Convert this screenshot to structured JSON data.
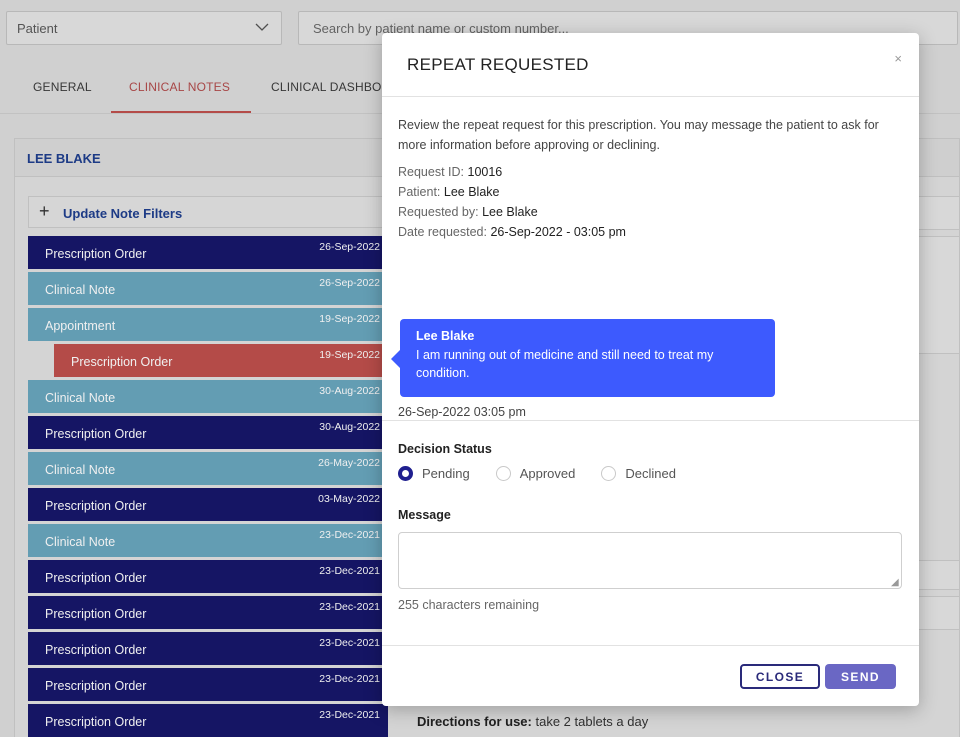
{
  "topbar": {
    "patient_select": {
      "value": "Patient",
      "icon": "chevron-down-icon"
    },
    "search": {
      "placeholder": "Search by patient name or custom number..."
    }
  },
  "tabs": [
    {
      "label": "GENERAL",
      "active": false
    },
    {
      "label": "CLINICAL NOTES",
      "active": true
    },
    {
      "label": "CLINICAL DASHBO",
      "active": false
    }
  ],
  "patient_card": {
    "title": "LEE BLAKE",
    "filter_button": {
      "icon": "plus-icon",
      "label": "Update Note Filters"
    },
    "notes": [
      {
        "label": "Prescription Order",
        "date": "26-Sep-2022",
        "kind": "dark"
      },
      {
        "label": "Clinical Note",
        "date": "26-Sep-2022",
        "kind": "light"
      },
      {
        "label": "Appointment",
        "date": "19-Sep-2022",
        "kind": "light"
      },
      {
        "label": "Prescription Order",
        "date": "19-Sep-2022",
        "kind": "red"
      },
      {
        "label": "Clinical Note",
        "date": "30-Aug-2022",
        "kind": "light"
      },
      {
        "label": "Prescription Order",
        "date": "30-Aug-2022",
        "kind": "dark"
      },
      {
        "label": "Clinical Note",
        "date": "26-May-2022",
        "kind": "light"
      },
      {
        "label": "Prescription Order",
        "date": "03-May-2022",
        "kind": "dark"
      },
      {
        "label": "Clinical Note",
        "date": "23-Dec-2021",
        "kind": "light"
      },
      {
        "label": "Prescription Order",
        "date": "23-Dec-2021",
        "kind": "dark"
      },
      {
        "label": "Prescription Order",
        "date": "23-Dec-2021",
        "kind": "dark"
      },
      {
        "label": "Prescription Order",
        "date": "23-Dec-2021",
        "kind": "dark"
      },
      {
        "label": "Prescription Order",
        "date": "23-Dec-2021",
        "kind": "dark"
      },
      {
        "label": "Prescription Order",
        "date": "23-Dec-2021",
        "kind": "dark"
      }
    ],
    "directions": {
      "label": "Directions for use:",
      "value": "take 2 tablets a day"
    }
  },
  "modal": {
    "title": "REPEAT REQUESTED",
    "close_glyph": "×",
    "intro": "Review the repeat request for this prescription. You may message the patient to ask for more information before approving or declining.",
    "meta": [
      {
        "label": "Request ID:",
        "value": "10016"
      },
      {
        "label": "Patient:",
        "value": "Lee Blake"
      },
      {
        "label": "Requested by:",
        "value": "Lee Blake"
      },
      {
        "label": "Date requested:",
        "value": "26-Sep-2022 - 03:05 pm"
      }
    ],
    "message": {
      "sender": "Lee Blake",
      "text": "I am running out of medicine and still need to treat my condition.",
      "time": "26-Sep-2022 03:05 pm",
      "color": "#3d5afe"
    },
    "decision": {
      "label": "Decision Status",
      "options": [
        "Pending",
        "Approved",
        "Declined"
      ],
      "selected": "Pending"
    },
    "message_field": {
      "label": "Message",
      "value": "",
      "remaining": "255 characters remaining"
    },
    "buttons": {
      "close": "CLOSE",
      "send": "SEND"
    }
  },
  "colors": {
    "dark_note": "#17176b",
    "light_note": "#6aa7bf",
    "red_note": "#c0504d",
    "title_blue": "#1f3f8f",
    "send_button": "#6a67c4"
  }
}
